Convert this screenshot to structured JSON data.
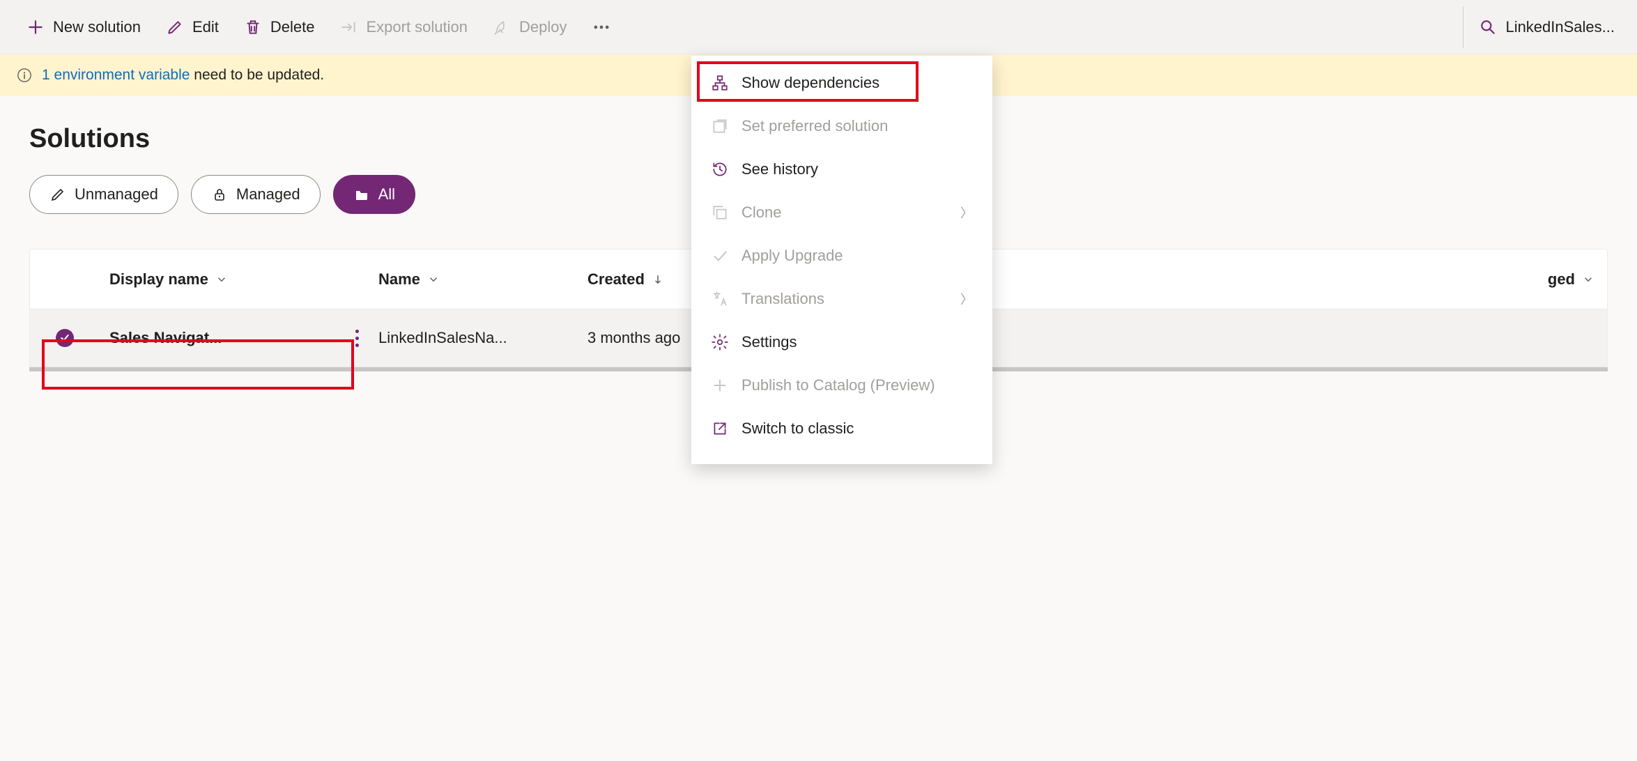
{
  "toolbar": {
    "new_solution": "New solution",
    "edit": "Edit",
    "delete": "Delete",
    "export": "Export solution",
    "deploy": "Deploy"
  },
  "search": {
    "text": "LinkedInSales..."
  },
  "banner": {
    "link": "1 environment variable",
    "text": "need to be updated."
  },
  "page": {
    "title": "Solutions"
  },
  "pills": {
    "unmanaged": "Unmanaged",
    "managed": "Managed",
    "all": "All"
  },
  "columns": {
    "display": "Display name",
    "name": "Name",
    "created": "Created",
    "managed": "ged"
  },
  "row": {
    "display": "Sales Navigat...",
    "name": "LinkedInSalesNa...",
    "created": "3 months ago"
  },
  "menu": {
    "show_dependencies": "Show dependencies",
    "set_preferred": "Set preferred solution",
    "see_history": "See history",
    "clone": "Clone",
    "apply_upgrade": "Apply Upgrade",
    "translations": "Translations",
    "settings": "Settings",
    "publish_catalog": "Publish to Catalog (Preview)",
    "switch_classic": "Switch to classic"
  }
}
